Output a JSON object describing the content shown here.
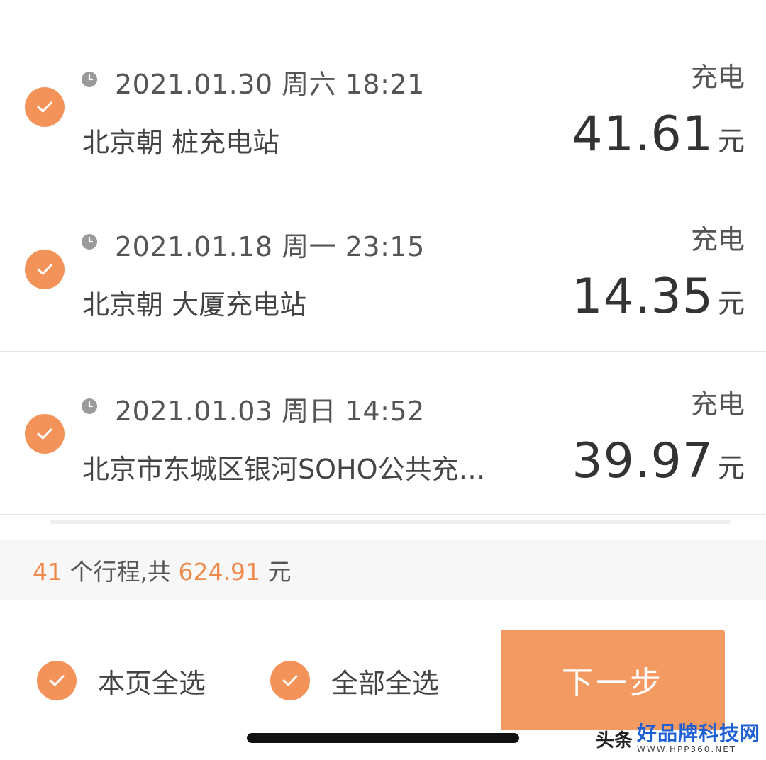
{
  "trips": [
    {
      "datetime": "2021.01.30 周六 18:21",
      "station": "北京朝        桩充电站",
      "type": "充电",
      "amount": "41.61",
      "unit": "元",
      "checked": true
    },
    {
      "datetime": "2021.01.18 周一 23:15",
      "station": "北京朝           大厦充电站",
      "type": "充电",
      "amount": "14.35",
      "unit": "元",
      "checked": true
    },
    {
      "datetime": "2021.01.03 周日 14:52",
      "station": "北京市东城区银河SOHO公共充…",
      "type": "充电",
      "amount": "39.97",
      "unit": "元",
      "checked": true
    }
  ],
  "summary": {
    "count": "41",
    "count_suffix": " 个行程,共 ",
    "total": "624.91",
    "total_suffix": " 元"
  },
  "footer": {
    "select_page_label": "本页全选",
    "select_all_label": "全部全选",
    "next_label": "下一步"
  },
  "watermark": {
    "prefix": "头条",
    "title": "好品牌科技网",
    "url": "WWW.HPP360.NET"
  },
  "colors": {
    "accent": "#f3935a",
    "button": "#f39a63",
    "highlight": "#f08a4c"
  },
  "icons": {
    "check": "check-circle-icon",
    "clock": "clock-icon"
  }
}
